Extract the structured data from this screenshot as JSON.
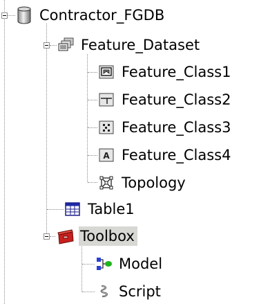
{
  "tree": {
    "root": {
      "label": "Contractor_FGDB",
      "icon": "database-icon",
      "expanded": true,
      "children": {
        "feature_dataset": {
          "label": "Feature_Dataset",
          "icon": "feature-dataset-icon",
          "expanded": true,
          "items": [
            {
              "label": "Feature_Class1",
              "icon": "polygon-feature-class-icon"
            },
            {
              "label": "Feature_Class2",
              "icon": "line-feature-class-icon"
            },
            {
              "label": "Feature_Class3",
              "icon": "point-feature-class-icon"
            },
            {
              "label": "Feature_Class4",
              "icon": "annotation-feature-class-icon"
            },
            {
              "label": "Topology",
              "icon": "topology-icon"
            }
          ]
        },
        "table": {
          "label": "Table1",
          "icon": "table-icon"
        },
        "toolbox": {
          "label": "Toolbox",
          "icon": "toolbox-icon",
          "expanded": true,
          "selected": true,
          "items": [
            {
              "label": "Model",
              "icon": "model-icon"
            },
            {
              "label": "Script",
              "icon": "script-icon"
            }
          ]
        }
      }
    }
  },
  "colors": {
    "tree_line": "#8a8a8a",
    "selection_background": "#d7d7d4",
    "model_blue": "#2a3fd8",
    "model_green": "#1eb41e",
    "toolbox_red": "#c8201e",
    "background": "#ffffff"
  }
}
